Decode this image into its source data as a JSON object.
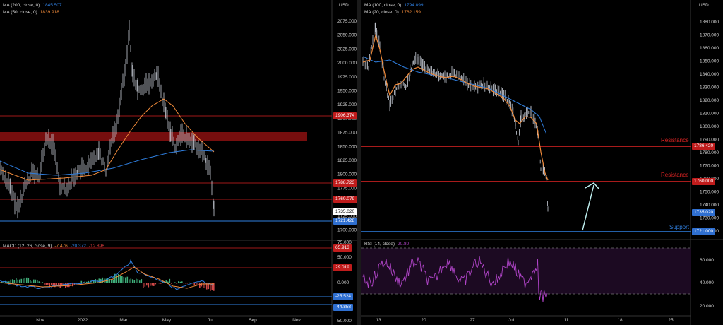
{
  "left": {
    "currency": "USD",
    "legend": [
      {
        "label": "MA (200, close, 0)",
        "value": "1845.507",
        "color": "#2f7fe0"
      },
      {
        "label": "MA (50, close, 0)",
        "value": "1839.918",
        "color": "#f08a3a"
      }
    ],
    "price_ticks": [
      "2075.000",
      "2050.000",
      "2025.000",
      "2000.000",
      "1975.000",
      "1950.000",
      "1925.000",
      "1900.000",
      "1875.000",
      "1850.000",
      "1825.000",
      "1800.000",
      "1775.000",
      "1750.000",
      "1725.000",
      "1700.000"
    ],
    "price_tags": {
      "level_1906": "1906.374",
      "level_1788": "1788.723",
      "level_1760": "1760.079",
      "last_price": "1735.020",
      "level_1721": "1721.428"
    },
    "macd": {
      "legend_label": "MACD (12, 26, close, 9)",
      "v1": "-7.476",
      "v2": "-20.372",
      "v3": "-12.896",
      "ticks": [
        "75.000",
        "50.000",
        "0.000"
      ],
      "tags": {
        "upper": "65.913",
        "mid": "29.019",
        "low1": "-25.524",
        "low2": "-44.858"
      },
      "bottom_tick": "50.000"
    },
    "time_labels": [
      "Nov",
      "2022",
      "Mar",
      "May",
      "Jul",
      "Sep",
      "Nov"
    ]
  },
  "right": {
    "currency": "USD",
    "legend": [
      {
        "label": "MA (100, close, 0)",
        "value": "1794.899",
        "color": "#2f7fe0"
      },
      {
        "label": "MA (20, close, 0)",
        "value": "1762.159",
        "color": "#f08a3a"
      }
    ],
    "price_ticks": [
      "1880.000",
      "1870.000",
      "1860.000",
      "1850.000",
      "1840.000",
      "1830.000",
      "1820.000",
      "1810.000",
      "1800.000",
      "1790.000",
      "1780.000",
      "1770.000",
      "1760.000",
      "1750.000",
      "1740.000",
      "1730.000",
      "1720.000"
    ],
    "price_tags": {
      "resistance_1": "1786.420",
      "resistance_2": "1760.000",
      "last_price": "1735.020",
      "support": "1721.000"
    },
    "annotations": {
      "resistance_upper": "Resistance",
      "resistance_lower": "Resistance",
      "support": "Support"
    },
    "rsi": {
      "legend_label": "RSI (14, close)",
      "value": "20.80",
      "ticks": [
        "60.000",
        "40.000",
        "20.000"
      ]
    },
    "time_labels": [
      "13",
      "20",
      "27",
      "Jul",
      "11",
      "18",
      "25"
    ]
  },
  "colors": {
    "ma_long": "#2f7fe0",
    "ma_short": "#f08a3a",
    "resistance": "#e02424",
    "support": "#2f7fe0",
    "rsi": "#b044c8",
    "arrow": "#bfeff0"
  }
}
